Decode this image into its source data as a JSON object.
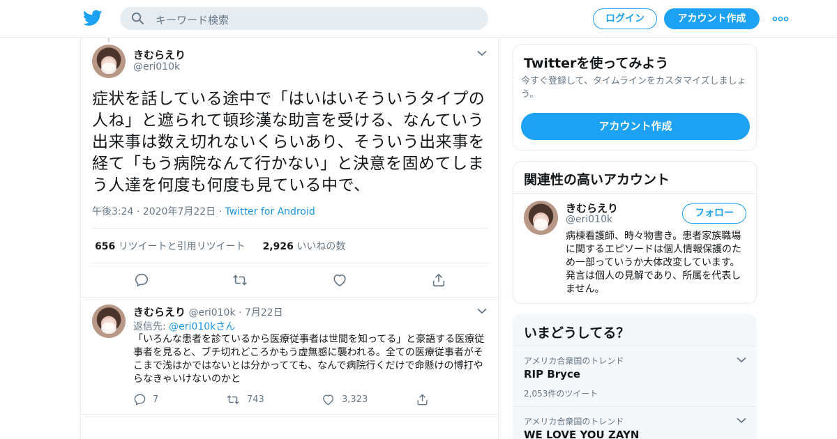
{
  "header": {
    "search_placeholder": "キーワード検索",
    "login_label": "ログイン",
    "signup_label": "アカウント作成",
    "brand_color": "#1da1f2"
  },
  "tweet": {
    "author_name": "きむらえり",
    "author_handle": "@eri010k",
    "text": "症状を話している途中で「はいはいそういうタイプの人ね」と遮られて頓珍漢な助言を受ける、なんていう出来事は数え切れないくらいあり、そういう出来事を経て「もう病院なんて行かない」と決意を固めてしまう人達を何度も何度も見ている中で、",
    "time": "午後3:24",
    "date": "2020年7月22日",
    "source": "Twitter for Android",
    "retweet_count": "656",
    "retweet_label": "リツイートと引用リツイート",
    "like_count": "2,926",
    "like_label": "いいねの数"
  },
  "reply": {
    "author_name": "きむらえり",
    "author_handle": "@eri010k",
    "date": "7月22日",
    "reply_to_label": "返信先:",
    "reply_to_handle": "@eri010kさん",
    "text": "「いろんな患者を診ているから医療従事者は世間を知ってる」と豪語する医療従事者を見ると、ブチ切れどころかもう虚無感に襲われる。全ての医療従事者がそこまで浅はかではないとは分かってても、なんで病院行くだけで命懸けの博打やらなきゃいけないのかと",
    "reply_count": "7",
    "retweet_count": "743",
    "like_count": "3,323"
  },
  "sidebar": {
    "signup_card": {
      "title": "Twitterを使ってみよう",
      "subtitle": "今すぐ登録して、タイムラインをカスタマイズしましょう。",
      "button_label": "アカウント作成"
    },
    "related": {
      "title": "関連性の高いアカウント",
      "name": "きむらえり",
      "handle": "@eri010k",
      "follow_label": "フォロー",
      "bio": "病棟看護師、時々物書き。患者家族職場に関するエピソードは個人情報保護のため一部っていうか大体改変しています。発言は個人の見解であり、所属を代表しません。"
    },
    "trends": {
      "title": "いまどうしてる？",
      "items": [
        {
          "context": "アメリカ合衆国のトレンド",
          "name": "RIP Bryce",
          "count": "2,053件のツイート"
        },
        {
          "context": "アメリカ合衆国のトレンド",
          "name": "WE LOVE YOU ZAYN",
          "count": ""
        }
      ]
    }
  }
}
